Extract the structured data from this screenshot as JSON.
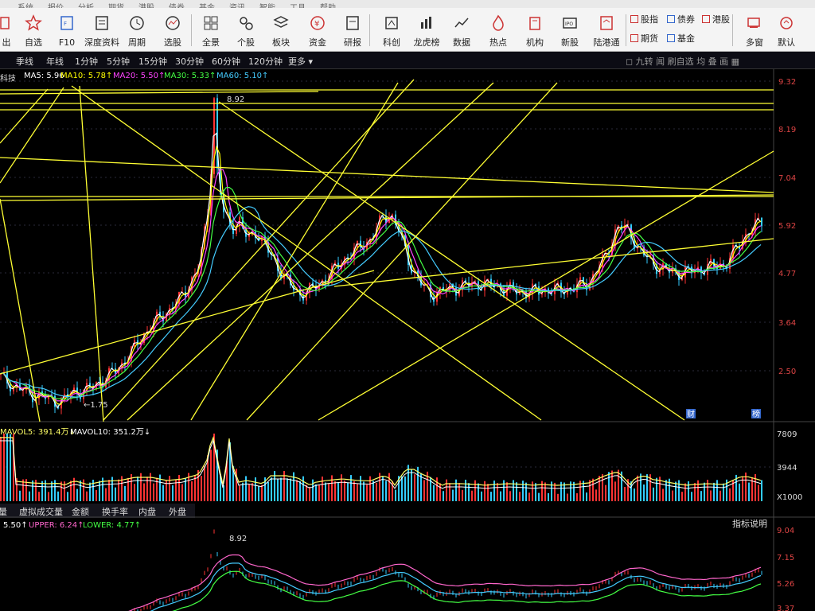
{
  "menu": [
    "系统",
    "报价",
    "分析",
    "期货",
    "港股",
    "债券",
    "基金",
    "资讯",
    "智能",
    "工具",
    "帮助"
  ],
  "toolbar": [
    {
      "label": "出",
      "icon": "exit-icon"
    },
    {
      "label": "自选",
      "icon": "star-icon"
    },
    {
      "label": "F10",
      "icon": "f10-icon"
    },
    {
      "label": "深度资料",
      "icon": "document-icon"
    },
    {
      "label": "周期",
      "icon": "clock-icon"
    },
    {
      "label": "选股",
      "icon": "stock-pick-icon"
    },
    {
      "label": "全景",
      "icon": "grid-icon"
    },
    {
      "label": "个股",
      "icon": "stock-icon"
    },
    {
      "label": "板块",
      "icon": "layers-icon"
    },
    {
      "label": "资金",
      "icon": "money-icon"
    },
    {
      "label": "研报",
      "icon": "report-icon"
    },
    {
      "label": "科创",
      "icon": "science-icon"
    },
    {
      "label": "龙虎榜",
      "icon": "bar-chart-icon"
    },
    {
      "label": "数据",
      "icon": "line-chart-icon"
    },
    {
      "label": "热点",
      "icon": "flame-icon"
    },
    {
      "label": "机构",
      "icon": "building-icon"
    },
    {
      "label": "新股",
      "icon": "ipo-icon"
    },
    {
      "label": "陆港通",
      "icon": "connect-icon"
    }
  ],
  "markets": [
    {
      "label": "股指"
    },
    {
      "label": "债券"
    },
    {
      "label": "港股"
    },
    {
      "label": "期货"
    },
    {
      "label": "基金"
    }
  ],
  "right_tools": {
    "multi": "多窗",
    "default": "默认"
  },
  "periods": [
    "季线",
    "年线",
    "1分钟",
    "5分钟",
    "15分钟",
    "30分钟",
    "60分钟",
    "120分钟",
    "更多"
  ],
  "period_right": "◻ 九转 闻 刷自选 均 叠 画 ▦",
  "stock_suffix": "科技",
  "ma": {
    "ma5": "MA5: 5.96",
    "ma10": "MA10: 5.78↑",
    "ma20": "MA20: 5.50↑",
    "ma30": "MA30: 5.33↑",
    "ma60": "MA60: 5.10↑"
  },
  "colors": {
    "ma5": "#ffffff",
    "ma10": "#ffff00",
    "ma20": "#ff44ff",
    "ma30": "#44ff44",
    "ma60": "#44ccff",
    "up": "#ff3333",
    "down": "#33ccff",
    "drawing": "#ffff33",
    "bg": "#000000"
  },
  "price_axis": [
    "9.32",
    "8.19",
    "7.04",
    "5.92",
    "4.77",
    "3.64",
    "2.50"
  ],
  "annotations": {
    "high": "8.92",
    "low": "1.75",
    "tag1": "财",
    "tag2": "榜"
  },
  "volume": {
    "mavol5": "MAVOL5: 391.4万↓",
    "mavol10": "MAVOL10: 351.2万↓",
    "axis": [
      "7809",
      "3944",
      "X1000"
    ]
  },
  "subtabs": [
    "量",
    "虚拟成交量",
    "金额",
    "换手率",
    "内盘",
    "外盘"
  ],
  "bottom": {
    "mid": "5.50↑",
    "upper": "UPPER: 6.24↑",
    "lower": "LOWER: 4.77↑",
    "info_button": "指标说明",
    "axis": [
      "9.04",
      "7.15",
      "5.26",
      "3.37"
    ],
    "high": "8.92"
  }
}
